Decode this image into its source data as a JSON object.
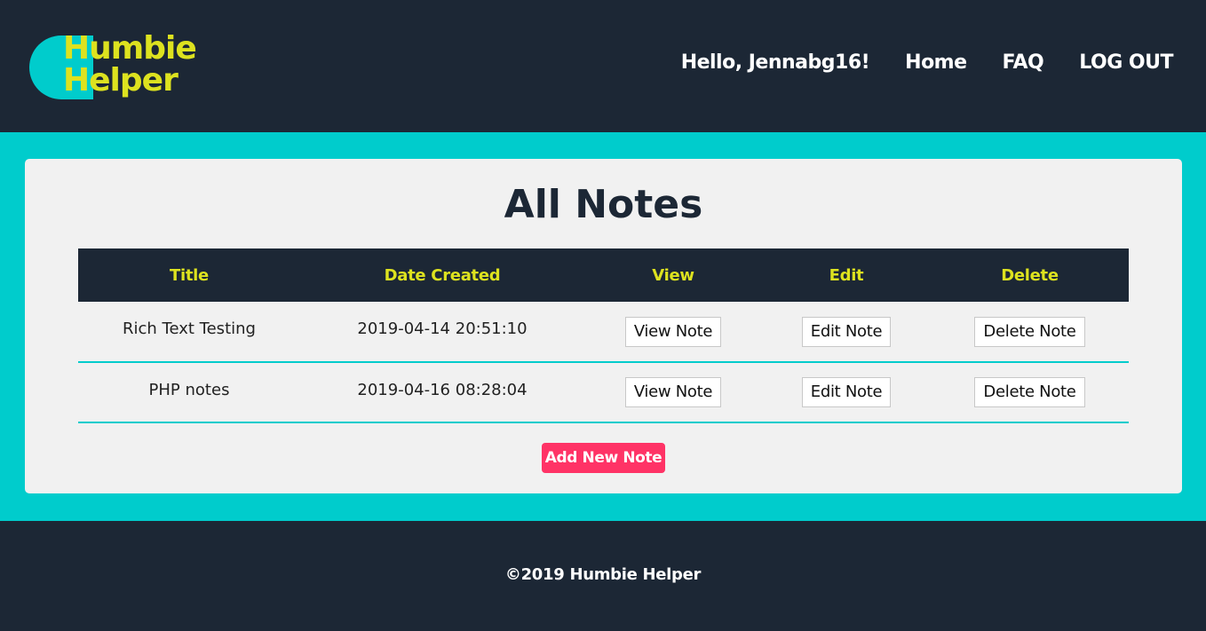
{
  "brand": {
    "logo_text": "Humbie\nHelper",
    "accent_color": "#00cccc",
    "text_color": "#dde21f"
  },
  "nav": {
    "greeting": "Hello, Jennabg16!",
    "home": "Home",
    "faq": "FAQ",
    "logout": "LOG OUT"
  },
  "main": {
    "title": "All Notes",
    "table": {
      "headers": [
        "Title",
        "Date Created",
        "View",
        "Edit",
        "Delete"
      ],
      "rows": [
        {
          "title": "Rich Text Testing",
          "date": "2019-04-14 20:51:10",
          "view_label": "View Note",
          "edit_label": "Edit Note",
          "delete_label": "Delete Note"
        },
        {
          "title": "PHP notes",
          "date": "2019-04-16 08:28:04",
          "view_label": "View Note",
          "edit_label": "Edit Note",
          "delete_label": "Delete Note"
        }
      ]
    },
    "add_button": "Add New Note"
  },
  "footer": {
    "text": "©2019 Humbie Helper"
  },
  "colors": {
    "dark": "#1c2735",
    "teal": "#00cccc",
    "yellow": "#dde21f",
    "pink": "#ff3366",
    "card": "#f1f1f1"
  }
}
